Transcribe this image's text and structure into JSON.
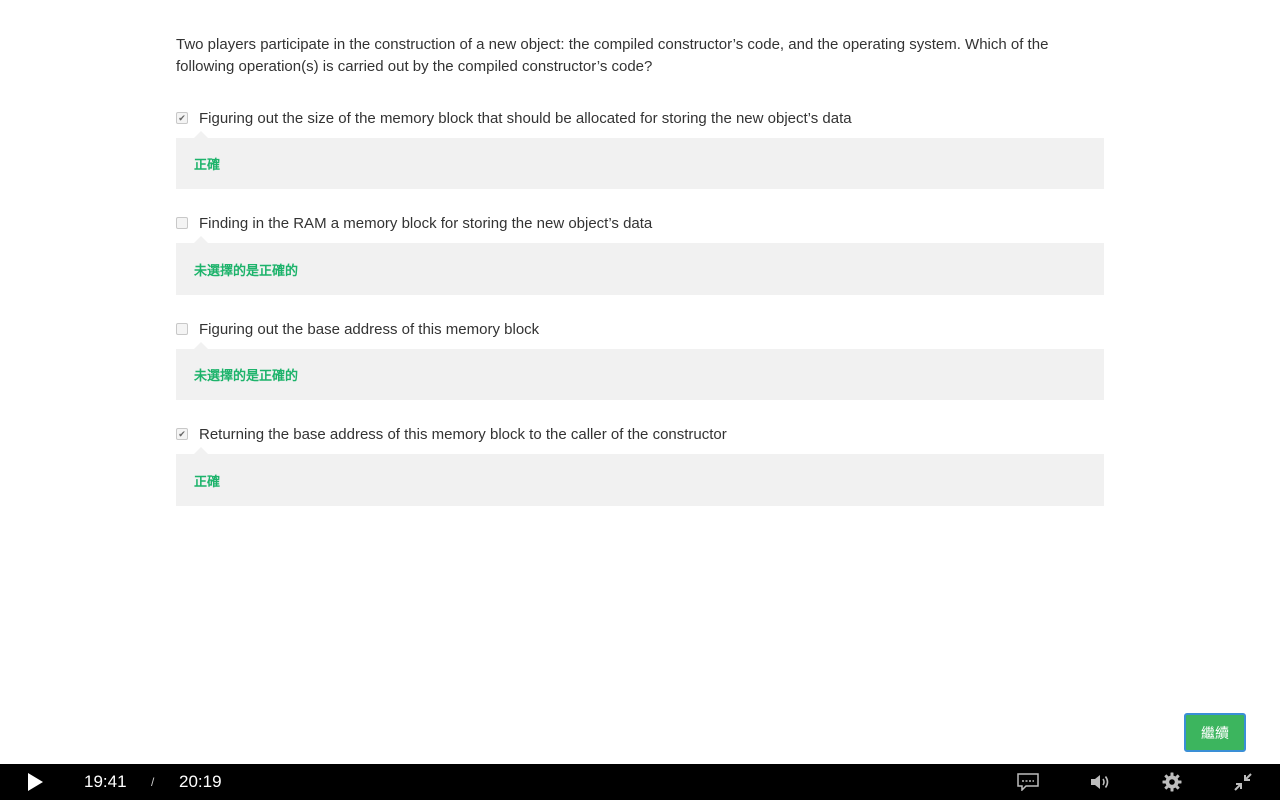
{
  "quiz": {
    "question": "Two players participate in the construction of a new object: the compiled constructor’s code, and the operating system. Which of the following operation(s) is carried out by the compiled constructor’s code?",
    "options": [
      {
        "label": "Figuring out the size of the memory block that should be allocated for storing the new object’s data",
        "checked": true,
        "feedback": "正確"
      },
      {
        "label": "Finding in the RAM a memory block for storing the new object’s data",
        "checked": false,
        "feedback": "未選擇的是正確的"
      },
      {
        "label": "Figuring out the base address of this memory block",
        "checked": false,
        "feedback": "未選擇的是正確的"
      },
      {
        "label": "Returning the base address of this memory block to the caller of the constructor",
        "checked": true,
        "feedback": "正確"
      }
    ],
    "feedback_color": "#1db36b"
  },
  "continue_button": {
    "label": "繼續",
    "color": "#3cb55e"
  },
  "player": {
    "current_time": "19:41",
    "separator": "/",
    "total_time": "20:19",
    "icons": [
      "play-icon",
      "captions-icon",
      "volume-icon",
      "settings-gear-icon",
      "exit-fullscreen-icon"
    ]
  }
}
